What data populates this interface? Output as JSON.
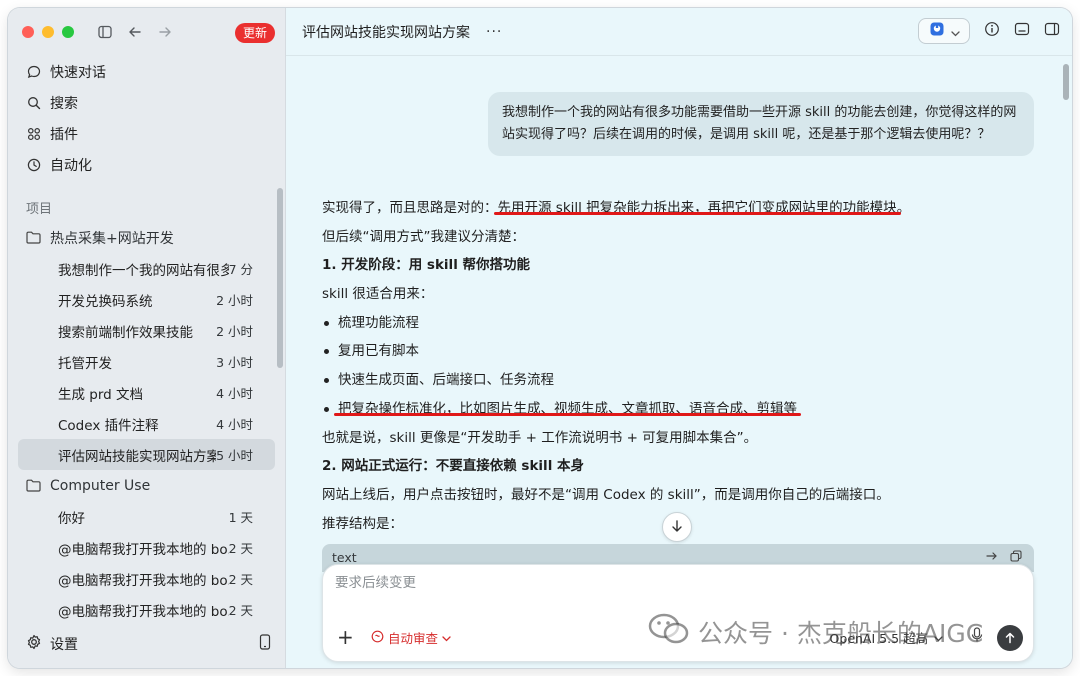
{
  "sidebar": {
    "update_label": "更新",
    "nav": [
      {
        "label": "快速对话",
        "icon": "chat-bubble-icon"
      },
      {
        "label": "搜索",
        "icon": "search-icon"
      },
      {
        "label": "插件",
        "icon": "plugin-grid-icon"
      },
      {
        "label": "自动化",
        "icon": "clock-icon"
      }
    ],
    "section_label": "项目",
    "folders": [
      {
        "name": "热点采集+网站开发",
        "chats": [
          {
            "title": "我想制作一个我的网站有很多功能需要借助一些开源",
            "time": "7 分"
          },
          {
            "title": "开发兑换码系统",
            "time": "2 小时"
          },
          {
            "title": "搜索前端制作效果技能",
            "time": "2 小时"
          },
          {
            "title": "托管开发",
            "time": "3 小时"
          },
          {
            "title": "生成 prd 文档",
            "time": "4 小时"
          },
          {
            "title": "Codex 插件注释",
            "time": "4 小时"
          },
          {
            "title": "评估网站技能实现网站方案",
            "time": "5 小时"
          }
        ]
      },
      {
        "name": "Computer Use",
        "chats": [
          {
            "title": "你好",
            "time": "1 天"
          },
          {
            "title": "@电脑帮我打开我本地的 bo...",
            "time": "2 天"
          },
          {
            "title": "@电脑帮我打开我本地的 bo...",
            "time": "2 天"
          },
          {
            "title": "@电脑帮我打开我本地的 bo...",
            "time": "2 天"
          }
        ]
      }
    ],
    "settings_label": "设置"
  },
  "header": {
    "title": "评估网站技能实现网站方案",
    "more": "···"
  },
  "conversation": {
    "user_message": "我想制作一个我的网站有很多功能需要借助一些开源 skill 的功能去创建，你觉得这样的网站实现得了吗？后续在调用的时候，是调用 skill 呢，还是基于那个逻辑去使用呢？？",
    "answer": {
      "l1_a": "实现得了，而且思路是对的：",
      "l1_b": "先用开源 skill 把复杂能力拆出来，再把它们变成网站里的功能模块",
      "l1_c": "。",
      "l2": "但后续“调用方式”我建议分清楚：",
      "h1": "1. 开发阶段：用 skill 帮你搭功能",
      "l3": "skill 很适合用来：",
      "b1": "梳理功能流程",
      "b2": "复用已有脚本",
      "b3": "快速生成页面、后端接口、任务流程",
      "b4": "把复杂操作标准化，比如图片生成、视频生成、文章抓取、语音合成、剪辑等",
      "l4": "也就是说，skill 更像是“开发助手 + 工作流说明书 + 可复用脚本集合”。",
      "h2": "2. 网站正式运行：不要直接依赖 skill 本身",
      "l5": "网站上线后，用户点击按钮时，最好不是“调用 Codex 的 skill”，而是调用你自己的后端接口。",
      "l6": "推荐结构是："
    },
    "code_lang": "text"
  },
  "composer": {
    "placeholder": "要求后续变更",
    "review_label": "自动审查",
    "model_label": "OpenAI 5.5 超高"
  },
  "watermark": "公众号 · 杰克船长的AIGC",
  "colors": {
    "accent_red": "#e01818",
    "update_red": "#ea2f2f",
    "sidebar_bg": "#e7ebef",
    "main_bg": "#e9f7fb"
  }
}
